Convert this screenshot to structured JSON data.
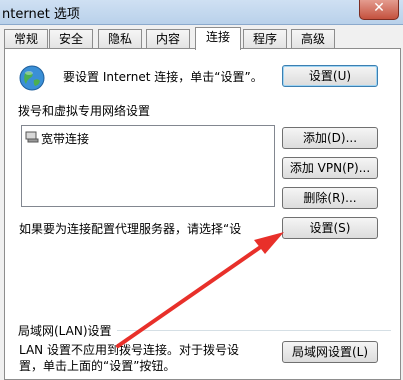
{
  "window": {
    "title": "nternet 选项",
    "close_label": "✕"
  },
  "tabs": [
    "常规",
    "安全",
    "隐私",
    "内容",
    "连接",
    "程序",
    "高级"
  ],
  "setup": {
    "text": "要设置 Internet 连接，单击“设置”。",
    "button": "设置(U)"
  },
  "dialup": {
    "heading": "拨号和虚拟专用网络设置",
    "items": [
      "宽带连接"
    ],
    "add_button": "添加(D)...",
    "add_vpn_button": "添加 VPN(P)...",
    "remove_button": "删除(R)...",
    "proxy_text": "如果要为连接配置代理服务器，请选择“设",
    "settings_button": "设置(S)"
  },
  "lan": {
    "heading": "局域网(LAN)设置",
    "line1": "LAN 设置不应用到拨号连接。对于拨号设",
    "line2": "置，单击上面的“设置”按钮。",
    "button": "局域网设置(L)"
  },
  "colors": {
    "arrow": "#e8302a",
    "accent": "#3c7fb1"
  }
}
